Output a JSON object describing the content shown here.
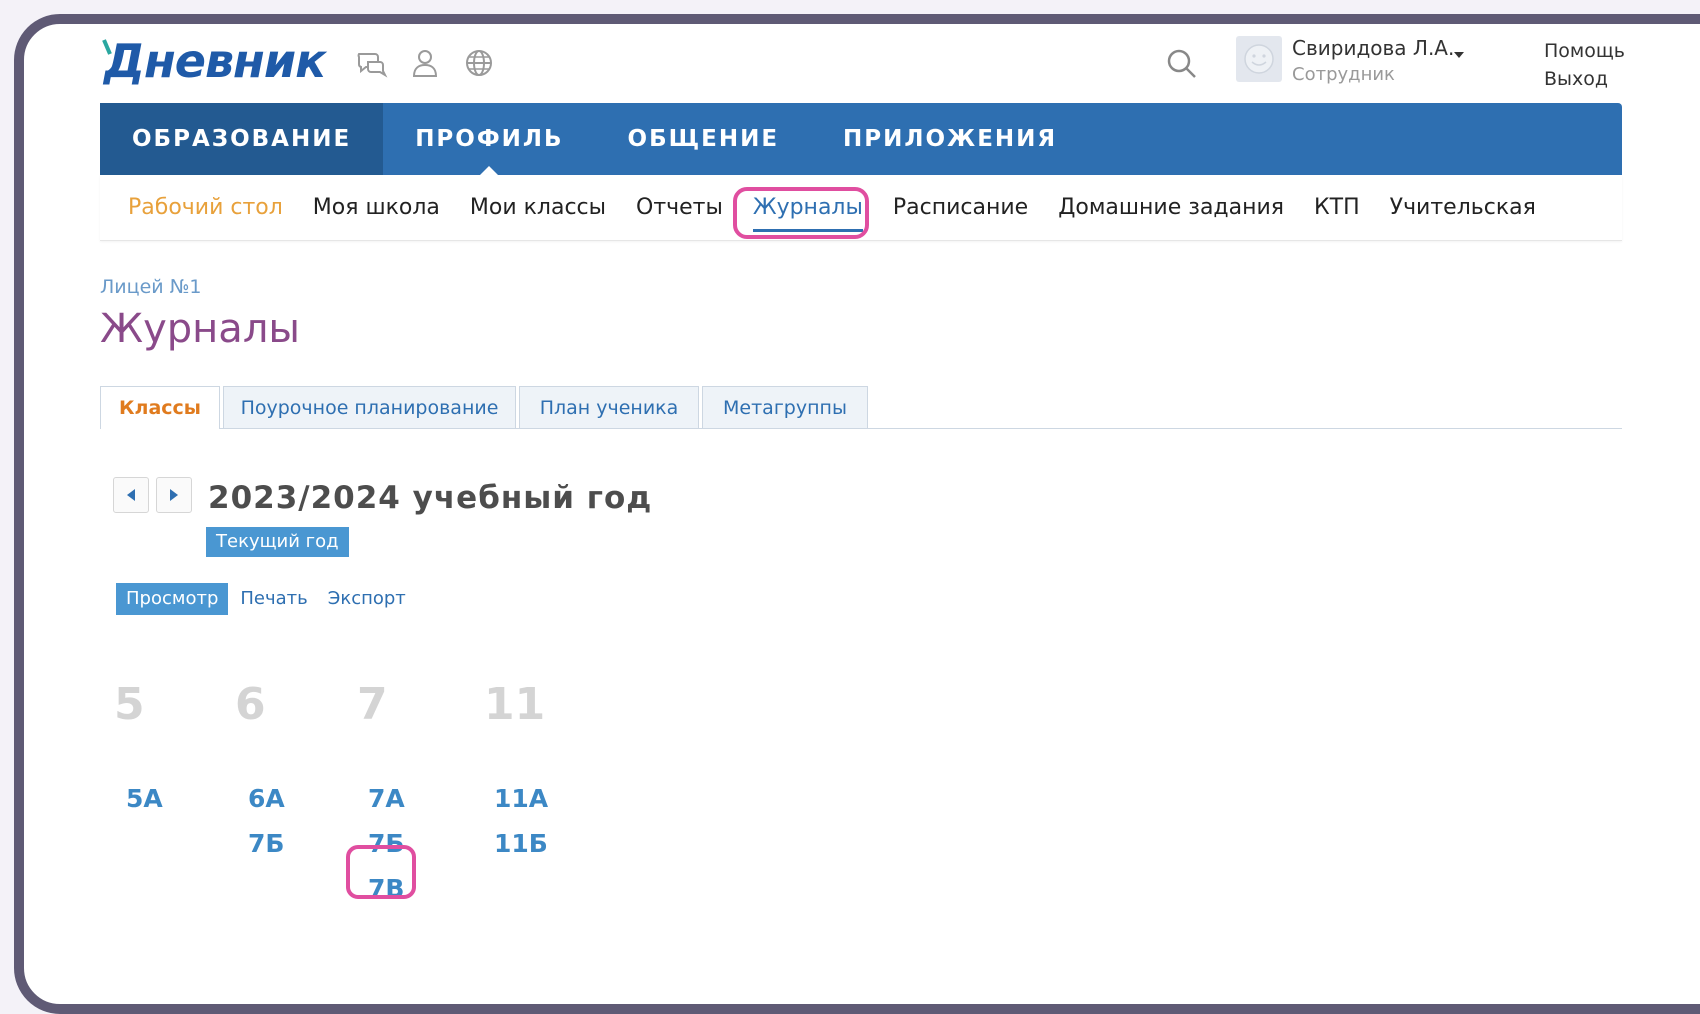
{
  "header": {
    "logo_text": "Дневник",
    "user_name": "Свиридова Л.А.",
    "user_role": "Сотрудник",
    "help_label": "Помощь",
    "logout_label": "Выход"
  },
  "main_nav": {
    "items": [
      "ОБРАЗОВАНИЕ",
      "ПРОФИЛЬ",
      "ОБЩЕНИЕ",
      "ПРИЛОЖЕНИЯ"
    ]
  },
  "sub_nav": {
    "items": [
      "Рабочий стол",
      "Моя школа",
      "Мои классы",
      "Отчеты",
      "Журналы",
      "Расписание",
      "Домашние задания",
      "КТП",
      "Учительская"
    ]
  },
  "breadcrumb": "Лицей №1",
  "page_title": "Журналы",
  "tabs": [
    "Классы",
    "Поурочное планирование",
    "План ученика",
    "Метагруппы"
  ],
  "year": {
    "title": "2023/2024 учебный год",
    "badge": "Текущий год"
  },
  "view_modes": [
    "Просмотр",
    "Печать",
    "Экспорт"
  ],
  "grades": [
    {
      "number": "5",
      "classes": [
        "5А"
      ]
    },
    {
      "number": "6",
      "classes": [
        "6А",
        "7Б"
      ]
    },
    {
      "number": "7",
      "classes": [
        "7А",
        "7Б",
        "7В"
      ]
    },
    {
      "number": "11",
      "classes": [
        "11А",
        "11Б"
      ]
    }
  ],
  "colors": {
    "nav_blue": "#2e6fb1",
    "nav_active": "#235a91",
    "highlight": "#e04ea0",
    "accent_orange": "#e8a13b",
    "title_purple": "#8a4a8a"
  }
}
